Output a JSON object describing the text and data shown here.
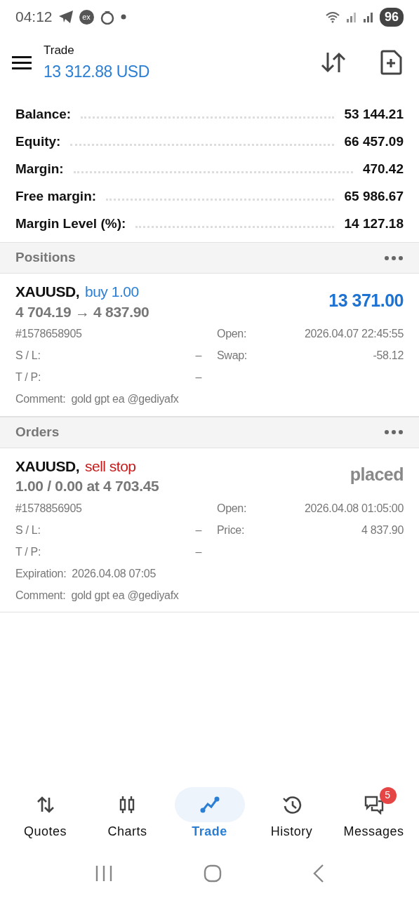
{
  "status_bar": {
    "time": "04:12",
    "app_badge": "ex",
    "battery": "96"
  },
  "header": {
    "title": "Trade",
    "balance": "13 312.88 USD"
  },
  "summary": [
    {
      "label": "Balance:",
      "value": "53 144.21"
    },
    {
      "label": "Equity:",
      "value": "66 457.09"
    },
    {
      "label": "Margin:",
      "value": "470.42"
    },
    {
      "label": "Free margin:",
      "value": "65 986.67"
    },
    {
      "label": "Margin Level (%):",
      "value": "14 127.18"
    }
  ],
  "sections": [
    {
      "title": "Positions",
      "kind": "position",
      "items": [
        {
          "symbol": "XAUUSD,",
          "kind": "buy",
          "action": "buy 1.00",
          "prices": "4 704.19 → 4 837.90",
          "result": "13 371.00",
          "rows": [
            [
              {
                "value": "#1578658905"
              },
              {
                "label": "Open:",
                "value": "2026.04.07 22:45:55"
              }
            ],
            [
              {
                "label": "S / L:",
                "value": "–"
              },
              {
                "label": "Swap:",
                "value": "-58.12"
              }
            ],
            [
              {
                "label": "T / P:",
                "value": "–"
              }
            ]
          ],
          "lines": [
            {
              "label": "Comment:",
              "value": "gold gpt ea @gediyafx"
            }
          ]
        }
      ]
    },
    {
      "title": "Orders",
      "kind": "order",
      "items": [
        {
          "symbol": "XAUUSD,",
          "kind": "sell",
          "action": "sell stop",
          "prices": "1.00 / 0.00 at 4 703.45",
          "result": "placed",
          "rows": [
            [
              {
                "value": "#1578856905"
              },
              {
                "label": "Open:",
                "value": "2026.04.08 01:05:00"
              }
            ],
            [
              {
                "label": "S / L:",
                "value": "–"
              },
              {
                "label": "Price:",
                "value": "4 837.90"
              }
            ],
            [
              {
                "label": "T / P:",
                "value": "–"
              }
            ]
          ],
          "lines": [
            {
              "label": "Expiration:",
              "value": "2026.04.08 07:05"
            },
            {
              "label": "Comment:",
              "value": "gold gpt ea @gediyafx"
            }
          ]
        }
      ]
    }
  ],
  "nav": [
    {
      "label": "Quotes",
      "kind": "quotes",
      "selected": false
    },
    {
      "label": "Charts",
      "kind": "charts",
      "selected": false
    },
    {
      "label": "Trade",
      "kind": "trade",
      "selected": true
    },
    {
      "label": "History",
      "kind": "history",
      "selected": false
    },
    {
      "label": "Messages",
      "kind": "messages",
      "selected": false,
      "badge": "5"
    }
  ]
}
